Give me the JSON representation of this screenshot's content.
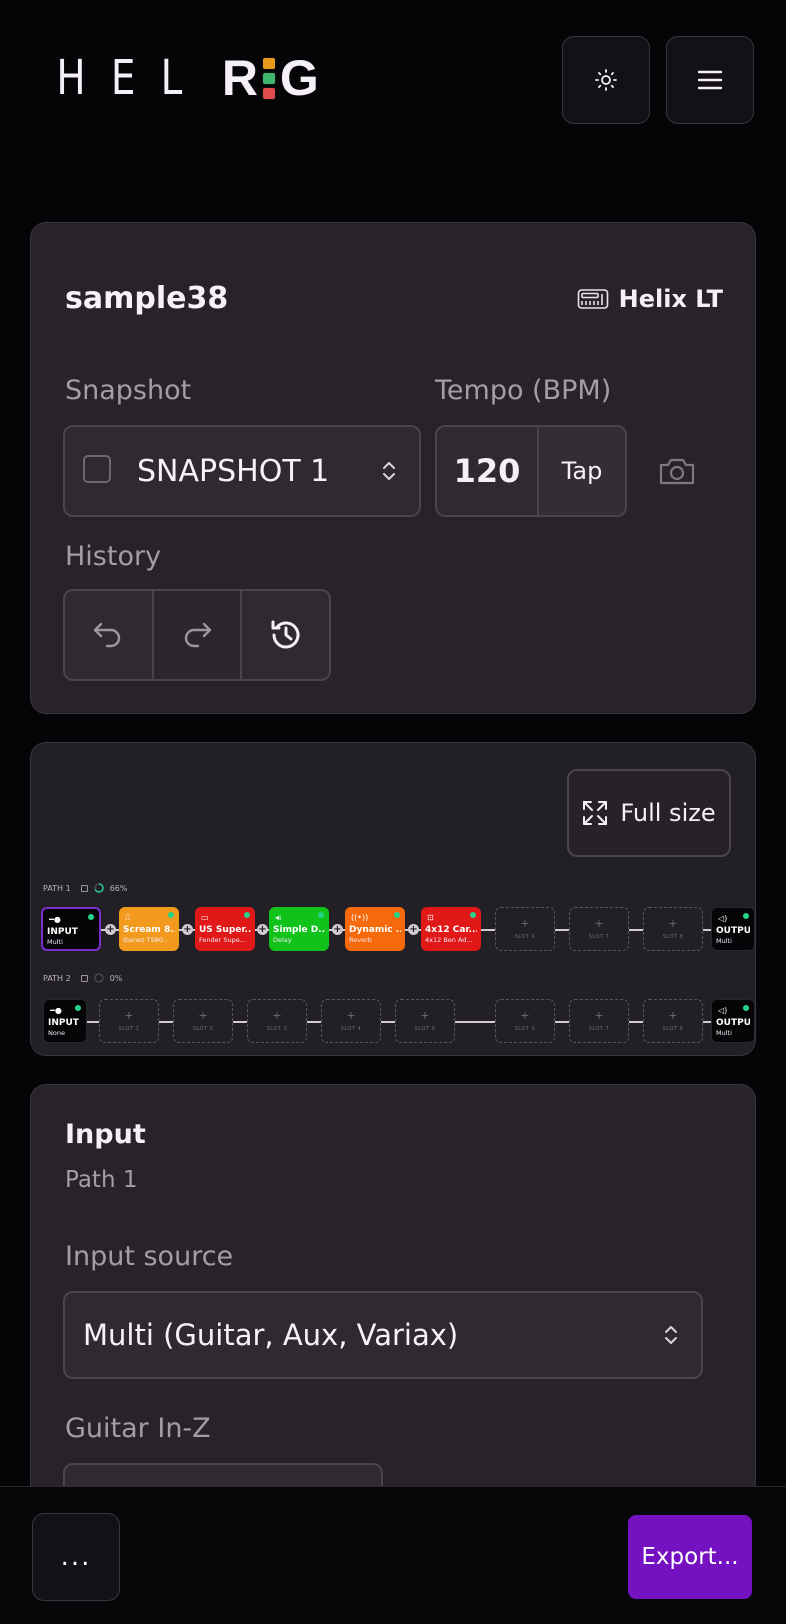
{
  "header": {
    "logo_thin": "HEL",
    "logo_r": "R",
    "logo_g": "G",
    "logo_i_colors": [
      "#e79a1a",
      "#3fb56e",
      "#e04b4b"
    ],
    "theme_icon": "sun-icon",
    "menu_icon": "hamburger-icon"
  },
  "preset": {
    "name": "sample38",
    "device": "Helix LT",
    "snapshot_label": "Snapshot",
    "snapshot_value": "SNAPSHOT 1",
    "tempo_label": "Tempo (BPM)",
    "tempo_value": "120",
    "tap_label": "Tap",
    "history_label": "History"
  },
  "signal_chain": {
    "fullsize_label": "Full size",
    "path1": {
      "label": "PATH 1",
      "percent": "66%",
      "blocks": [
        {
          "title": "INPUT",
          "sub": "Multi",
          "color": "#050407"
        },
        {
          "title": "Scream 8...",
          "sub": "Ibanez TS80...",
          "color": "#f29a1e"
        },
        {
          "title": "US Super...",
          "sub": "Fender Supe...",
          "color": "#e01818"
        },
        {
          "title": "Simple D...",
          "sub": "Delay",
          "color": "#11c21a"
        },
        {
          "title": "Dynamic ...",
          "sub": "Reverb",
          "color": "#f76a0b"
        },
        {
          "title": "4x12 Car...",
          "sub": "4x12 Ben Ad...",
          "color": "#e01818"
        },
        {
          "slot": "SLOT 6"
        },
        {
          "slot": "SLOT 7"
        },
        {
          "slot": "SLOT 8"
        },
        {
          "title": "OUTPUT",
          "sub": "Multi",
          "color": "#050407"
        }
      ]
    },
    "path2": {
      "label": "PATH 2",
      "percent": "0%",
      "blocks": [
        {
          "title": "INPUT",
          "sub": "None"
        },
        {
          "slot": "SLOT 1"
        },
        {
          "slot": "SLOT 2"
        },
        {
          "slot": "SLOT 3"
        },
        {
          "slot": "SLOT 4"
        },
        {
          "slot": "SLOT 5"
        },
        {
          "slot": "SLOT 6"
        },
        {
          "slot": "SLOT 7"
        },
        {
          "slot": "SLOT 8"
        },
        {
          "title": "OUTPUT",
          "sub": "Multi"
        }
      ]
    }
  },
  "input_panel": {
    "title": "Input",
    "subtitle": "Path 1",
    "source_label": "Input source",
    "source_value": "Multi (Guitar, Aux, Variax)",
    "inz_label": "Guitar In-Z"
  },
  "footer": {
    "more_label": "...",
    "export_label": "Export..."
  }
}
